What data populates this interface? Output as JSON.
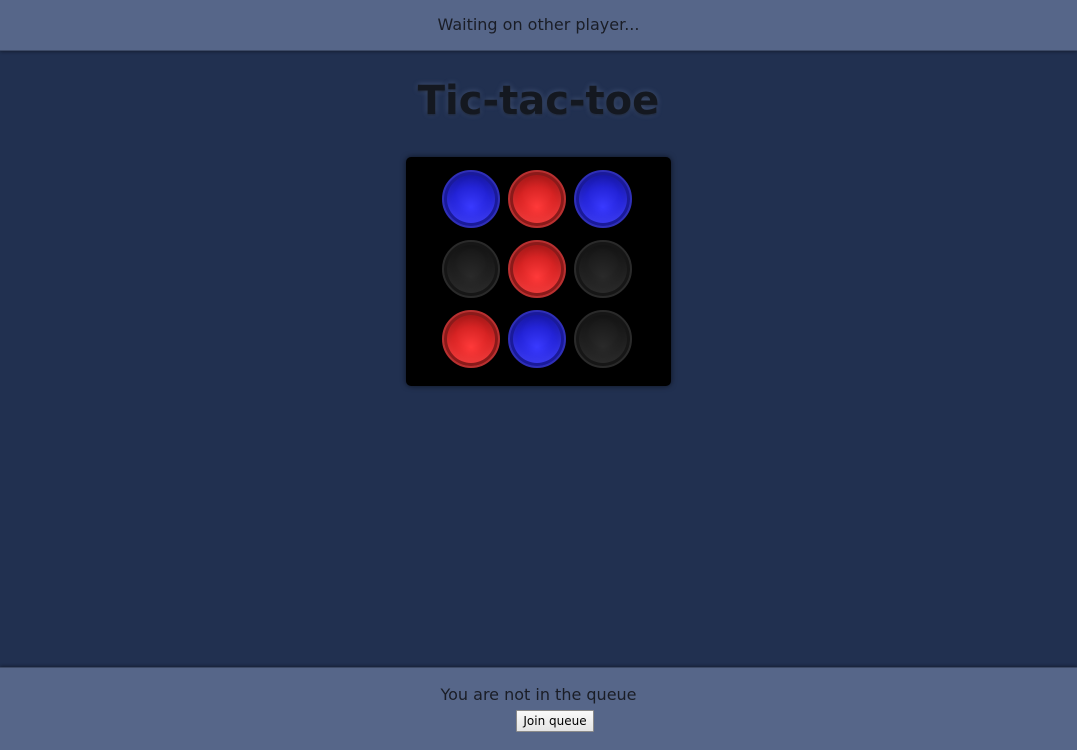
{
  "status_bar": {
    "message": "Waiting on other player..."
  },
  "game": {
    "title": "Tic-tac-toe",
    "board": [
      [
        "blue",
        "red",
        "blue"
      ],
      [
        "empty",
        "red",
        "empty"
      ],
      [
        "red",
        "blue",
        "empty"
      ]
    ],
    "colors": {
      "blue": "#2424d8",
      "red": "#d82424",
      "empty": "#1c1c1c"
    }
  },
  "queue": {
    "status": "You are not in the queue",
    "join_label": "Join queue"
  }
}
